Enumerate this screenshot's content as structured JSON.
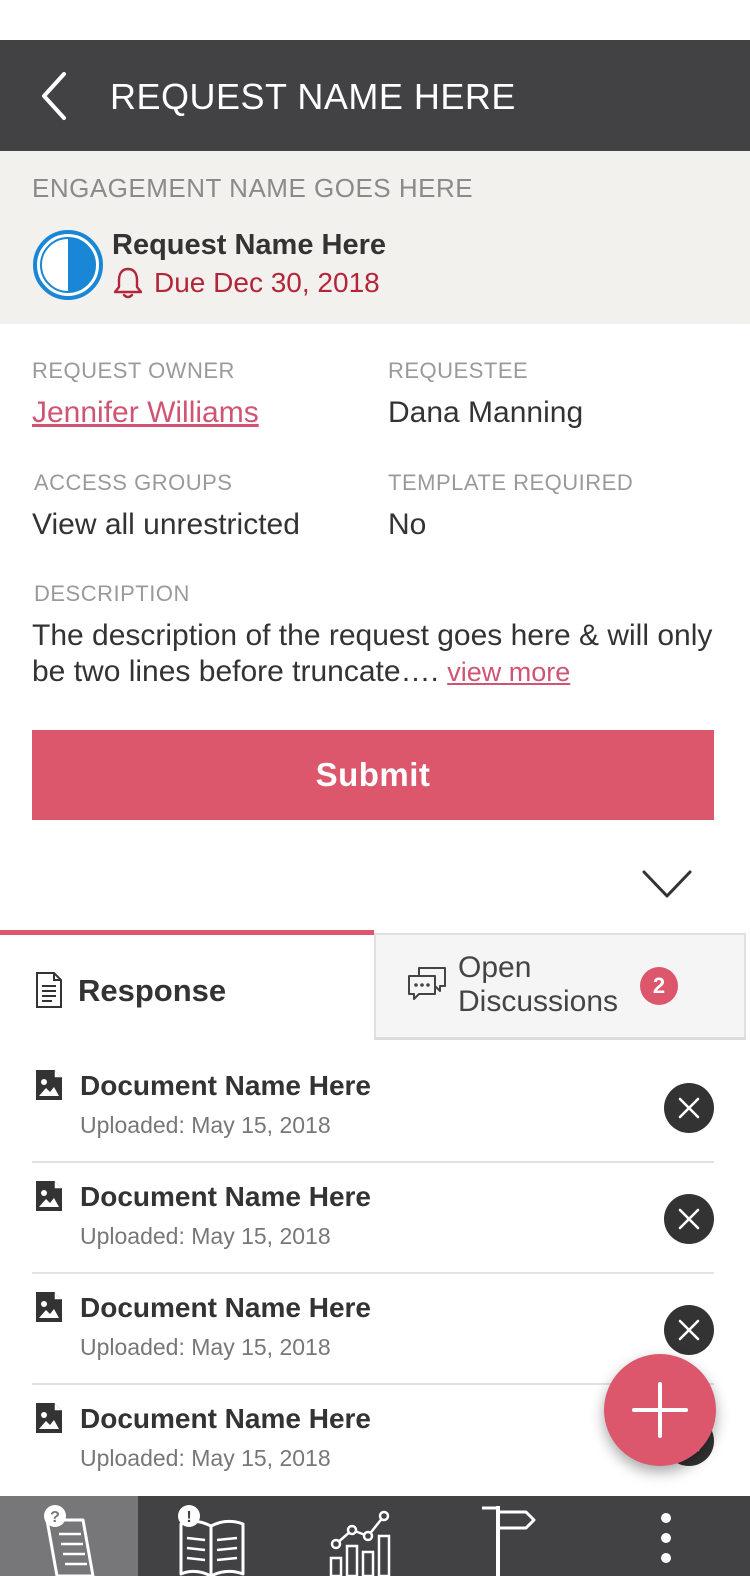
{
  "header": {
    "title": "REQUEST NAME HERE",
    "back_icon": "chevron-left-icon"
  },
  "engagement": {
    "name": "ENGAGEMENT NAME GOES HERE",
    "request_name": "Request Name Here",
    "due": "Due Dec 30, 2018",
    "status_icon": "half-filled-circle-icon",
    "due_icon": "bell-icon"
  },
  "details": {
    "owner_label": "REQUEST OWNER",
    "owner_value": "Jennifer Williams",
    "requestee_label": "REQUESTEE",
    "requestee_value": "Dana Manning",
    "access_label": "ACCESS GROUPS",
    "access_value": "View all unrestricted",
    "template_label": "TEMPLATE REQUIRED",
    "template_value": "No",
    "description_label": "DESCRIPTION",
    "description_text": "The description of the request goes here & will only be two lines before truncate…. ",
    "view_more": "view more"
  },
  "actions": {
    "submit_label": "Submit"
  },
  "tabs": {
    "response_label": "Response",
    "discussions_label": "Open Discussions",
    "discussions_count": "2"
  },
  "documents": [
    {
      "name": "Document Name Here",
      "uploaded": "Uploaded: May 15, 2018"
    },
    {
      "name": "Document Name Here",
      "uploaded": "Uploaded: May 15, 2018"
    },
    {
      "name": "Document Name Here",
      "uploaded": "Uploaded: May 15, 2018"
    },
    {
      "name": "Document Name Here",
      "uploaded": "Uploaded: May 15, 2018"
    }
  ],
  "bottom_nav": [
    {
      "icon": "request-scroll-icon",
      "active": true
    },
    {
      "icon": "alert-book-icon",
      "active": false
    },
    {
      "icon": "bar-chart-icon",
      "active": false
    },
    {
      "icon": "signpost-icon",
      "active": false
    },
    {
      "icon": "more-vertical-icon",
      "active": false
    }
  ],
  "colors": {
    "accent": "#dc566c",
    "header_bg": "#424244",
    "band_bg": "#f2f1ee",
    "due_red": "#b3263a",
    "status_blue": "#1a86d6"
  }
}
